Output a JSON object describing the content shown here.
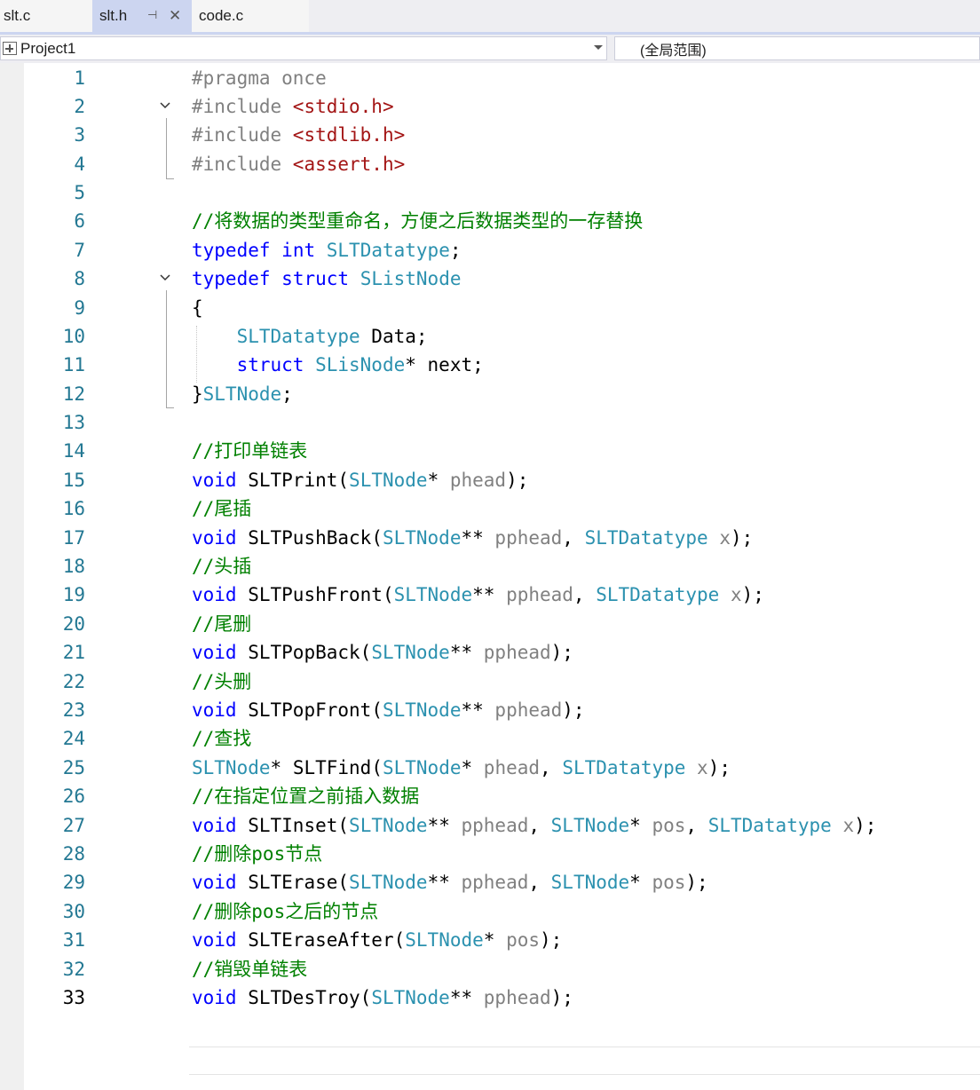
{
  "tabs": [
    {
      "label": "slt.c",
      "active": false
    },
    {
      "label": "slt.h",
      "active": true
    },
    {
      "label": "code.c",
      "active": false
    }
  ],
  "nav": {
    "project": "Project1",
    "scope": "(全局范围)"
  },
  "current_line": 33,
  "lines": [
    {
      "n": 1,
      "tokens": [
        [
          "pp",
          "#pragma once"
        ]
      ]
    },
    {
      "n": 2,
      "tokens": [
        [
          "pp",
          "#include "
        ],
        [
          "st",
          "<stdio.h>"
        ]
      ]
    },
    {
      "n": 3,
      "tokens": [
        [
          "pp",
          "#include "
        ],
        [
          "st",
          "<stdlib.h>"
        ]
      ]
    },
    {
      "n": 4,
      "tokens": [
        [
          "pp",
          "#include "
        ],
        [
          "st",
          "<assert.h>"
        ]
      ]
    },
    {
      "n": 5,
      "tokens": []
    },
    {
      "n": 6,
      "tokens": [
        [
          "cm",
          "//将数据的类型重命名，方便之后数据类型的一存替换"
        ]
      ]
    },
    {
      "n": 7,
      "tokens": [
        [
          "kw",
          "typedef"
        ],
        [
          "pu",
          " "
        ],
        [
          "kw",
          "int"
        ],
        [
          "pu",
          " "
        ],
        [
          "ty",
          "SLTDatatype"
        ],
        [
          "pu",
          ";"
        ]
      ]
    },
    {
      "n": 8,
      "tokens": [
        [
          "kw",
          "typedef"
        ],
        [
          "pu",
          " "
        ],
        [
          "kw",
          "struct"
        ],
        [
          "pu",
          " "
        ],
        [
          "ty",
          "SListNode"
        ]
      ]
    },
    {
      "n": 9,
      "tokens": [
        [
          "pu",
          "{"
        ]
      ]
    },
    {
      "n": 10,
      "tokens": [
        [
          "pu",
          "    "
        ],
        [
          "ty",
          "SLTDatatype"
        ],
        [
          "pu",
          " Data;"
        ]
      ]
    },
    {
      "n": 11,
      "tokens": [
        [
          "pu",
          "    "
        ],
        [
          "kw",
          "struct"
        ],
        [
          "pu",
          " "
        ],
        [
          "ty",
          "SLisNode"
        ],
        [
          "pu",
          "* next;"
        ]
      ]
    },
    {
      "n": 12,
      "tokens": [
        [
          "pu",
          "}"
        ],
        [
          "ty",
          "SLTNode"
        ],
        [
          "pu",
          ";"
        ]
      ]
    },
    {
      "n": 13,
      "tokens": []
    },
    {
      "n": 14,
      "tokens": [
        [
          "cm",
          "//打印单链表"
        ]
      ]
    },
    {
      "n": 15,
      "tokens": [
        [
          "kw",
          "void"
        ],
        [
          "pu",
          " "
        ],
        [
          "fn",
          "SLTPrint"
        ],
        [
          "pu",
          "("
        ],
        [
          "ty",
          "SLTNode"
        ],
        [
          "pu",
          "* "
        ],
        [
          "pr",
          "phead"
        ],
        [
          "pu",
          ");"
        ]
      ]
    },
    {
      "n": 16,
      "tokens": [
        [
          "cm",
          "//尾插"
        ]
      ]
    },
    {
      "n": 17,
      "tokens": [
        [
          "kw",
          "void"
        ],
        [
          "pu",
          " "
        ],
        [
          "fn",
          "SLTPushBack"
        ],
        [
          "pu",
          "("
        ],
        [
          "ty",
          "SLTNode"
        ],
        [
          "pu",
          "** "
        ],
        [
          "pr",
          "pphead"
        ],
        [
          "pu",
          ", "
        ],
        [
          "ty",
          "SLTDatatype"
        ],
        [
          "pu",
          " "
        ],
        [
          "pr",
          "x"
        ],
        [
          "pu",
          ");"
        ]
      ]
    },
    {
      "n": 18,
      "tokens": [
        [
          "cm",
          "//头插"
        ]
      ]
    },
    {
      "n": 19,
      "tokens": [
        [
          "kw",
          "void"
        ],
        [
          "pu",
          " "
        ],
        [
          "fn",
          "SLTPushFront"
        ],
        [
          "pu",
          "("
        ],
        [
          "ty",
          "SLTNode"
        ],
        [
          "pu",
          "** "
        ],
        [
          "pr",
          "pphead"
        ],
        [
          "pu",
          ", "
        ],
        [
          "ty",
          "SLTDatatype"
        ],
        [
          "pu",
          " "
        ],
        [
          "pr",
          "x"
        ],
        [
          "pu",
          ");"
        ]
      ]
    },
    {
      "n": 20,
      "tokens": [
        [
          "cm",
          "//尾删"
        ]
      ]
    },
    {
      "n": 21,
      "tokens": [
        [
          "kw",
          "void"
        ],
        [
          "pu",
          " "
        ],
        [
          "fn",
          "SLTPopBack"
        ],
        [
          "pu",
          "("
        ],
        [
          "ty",
          "SLTNode"
        ],
        [
          "pu",
          "** "
        ],
        [
          "pr",
          "pphead"
        ],
        [
          "pu",
          ");"
        ]
      ]
    },
    {
      "n": 22,
      "tokens": [
        [
          "cm",
          "//头删"
        ]
      ]
    },
    {
      "n": 23,
      "tokens": [
        [
          "kw",
          "void"
        ],
        [
          "pu",
          " "
        ],
        [
          "fn",
          "SLTPopFront"
        ],
        [
          "pu",
          "("
        ],
        [
          "ty",
          "SLTNode"
        ],
        [
          "pu",
          "** "
        ],
        [
          "pr",
          "pphead"
        ],
        [
          "pu",
          ");"
        ]
      ]
    },
    {
      "n": 24,
      "tokens": [
        [
          "cm",
          "//查找"
        ]
      ]
    },
    {
      "n": 25,
      "tokens": [
        [
          "ty",
          "SLTNode"
        ],
        [
          "pu",
          "* "
        ],
        [
          "fn",
          "SLTFind"
        ],
        [
          "pu",
          "("
        ],
        [
          "ty",
          "SLTNode"
        ],
        [
          "pu",
          "* "
        ],
        [
          "pr",
          "phead"
        ],
        [
          "pu",
          ", "
        ],
        [
          "ty",
          "SLTDatatype"
        ],
        [
          "pu",
          " "
        ],
        [
          "pr",
          "x"
        ],
        [
          "pu",
          ");"
        ]
      ]
    },
    {
      "n": 26,
      "tokens": [
        [
          "cm",
          "//在指定位置之前插入数据"
        ]
      ]
    },
    {
      "n": 27,
      "tokens": [
        [
          "kw",
          "void"
        ],
        [
          "pu",
          " "
        ],
        [
          "fn",
          "SLTInset"
        ],
        [
          "pu",
          "("
        ],
        [
          "ty",
          "SLTNode"
        ],
        [
          "pu",
          "** "
        ],
        [
          "pr",
          "pphead"
        ],
        [
          "pu",
          ", "
        ],
        [
          "ty",
          "SLTNode"
        ],
        [
          "pu",
          "* "
        ],
        [
          "pr",
          "pos"
        ],
        [
          "pu",
          ", "
        ],
        [
          "ty",
          "SLTDatatype"
        ],
        [
          "pu",
          " "
        ],
        [
          "pr",
          "x"
        ],
        [
          "pu",
          ");"
        ]
      ]
    },
    {
      "n": 28,
      "tokens": [
        [
          "cm",
          "//删除pos节点"
        ]
      ]
    },
    {
      "n": 29,
      "tokens": [
        [
          "kw",
          "void"
        ],
        [
          "pu",
          " "
        ],
        [
          "fn",
          "SLTErase"
        ],
        [
          "pu",
          "("
        ],
        [
          "ty",
          "SLTNode"
        ],
        [
          "pu",
          "** "
        ],
        [
          "pr",
          "pphead"
        ],
        [
          "pu",
          ", "
        ],
        [
          "ty",
          "SLTNode"
        ],
        [
          "pu",
          "* "
        ],
        [
          "pr",
          "pos"
        ],
        [
          "pu",
          ");"
        ]
      ]
    },
    {
      "n": 30,
      "tokens": [
        [
          "cm",
          "//删除pos之后的节点"
        ]
      ]
    },
    {
      "n": 31,
      "tokens": [
        [
          "kw",
          "void"
        ],
        [
          "pu",
          " "
        ],
        [
          "fn",
          "SLTEraseAfter"
        ],
        [
          "pu",
          "("
        ],
        [
          "ty",
          "SLTNode"
        ],
        [
          "pu",
          "* "
        ],
        [
          "pr",
          "pos"
        ],
        [
          "pu",
          ");"
        ]
      ]
    },
    {
      "n": 32,
      "tokens": [
        [
          "cm",
          "//销毁单链表"
        ]
      ]
    },
    {
      "n": 33,
      "tokens": [
        [
          "kw",
          "void"
        ],
        [
          "pu",
          " "
        ],
        [
          "fn",
          "SLTDesTroy"
        ],
        [
          "pu",
          "("
        ],
        [
          "ty",
          "SLTNode"
        ],
        [
          "pu",
          "** "
        ],
        [
          "pr",
          "pphead"
        ],
        [
          "pu",
          ");"
        ]
      ]
    }
  ]
}
